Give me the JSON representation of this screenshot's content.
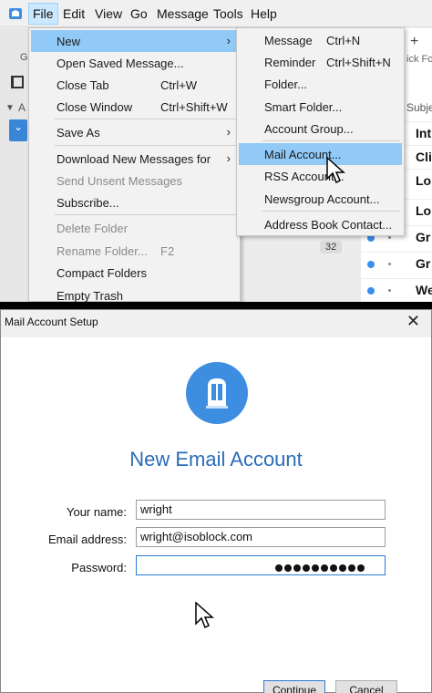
{
  "menubar": {
    "items": [
      "File",
      "Edit",
      "View",
      "Go",
      "Message",
      "Tools",
      "Help"
    ],
    "active": "File"
  },
  "background": {
    "left_toolbar_text": "G",
    "account_label": "A",
    "quick_filter_text": "ick Fo",
    "subject_header": "Subje",
    "message_rows": [
      "Int",
      "Cli",
      "Lo",
      "Lo",
      "Gr",
      "Gr",
      "We"
    ],
    "unread_count": "32"
  },
  "file_menu": {
    "items": [
      {
        "label": "New",
        "shortcut": "",
        "submenu": true,
        "disabled": false,
        "highlighted": true
      },
      {
        "label": "Open Saved Message...",
        "shortcut": "",
        "submenu": false,
        "disabled": false
      },
      {
        "label": "Close Tab",
        "shortcut": "Ctrl+W",
        "submenu": false,
        "disabled": false
      },
      {
        "label": "Close Window",
        "shortcut": "Ctrl+Shift+W",
        "submenu": false,
        "disabled": false
      },
      {
        "label": "Save As",
        "shortcut": "",
        "submenu": true,
        "disabled": false
      },
      {
        "label": "Download New Messages for",
        "shortcut": "",
        "submenu": true,
        "disabled": false
      },
      {
        "label": "Send Unsent Messages",
        "shortcut": "",
        "submenu": false,
        "disabled": true
      },
      {
        "label": "Subscribe...",
        "shortcut": "",
        "submenu": false,
        "disabled": false
      },
      {
        "label": "Delete Folder",
        "shortcut": "",
        "submenu": false,
        "disabled": true
      },
      {
        "label": "Rename Folder...",
        "shortcut": "F2",
        "submenu": false,
        "disabled": true
      },
      {
        "label": "Compact Folders",
        "shortcut": "",
        "submenu": false,
        "disabled": false
      },
      {
        "label": "Empty Trash",
        "shortcut": "",
        "submenu": false,
        "disabled": false
      }
    ]
  },
  "new_submenu": {
    "items": [
      {
        "label": "Message",
        "shortcut": "Ctrl+N"
      },
      {
        "label": "Reminder",
        "shortcut": "Ctrl+Shift+N"
      },
      {
        "label": "Folder...",
        "shortcut": ""
      },
      {
        "label": "Smart Folder...",
        "shortcut": ""
      },
      {
        "label": "Account Group...",
        "shortcut": ""
      },
      {
        "label": "Mail Account...",
        "shortcut": "",
        "highlighted": true
      },
      {
        "label": "RSS Account...",
        "shortcut": ""
      },
      {
        "label": "Newsgroup Account...",
        "shortcut": ""
      },
      {
        "label": "Address Book Contact...",
        "shortcut": ""
      }
    ]
  },
  "dialog": {
    "title": "Mail Account Setup",
    "close_icon": "close-icon",
    "logo_icon": "mailbox-icon",
    "headline": "New Email Account",
    "fields": {
      "name_label": "Your name:",
      "name_value": "wright",
      "email_label": "Email address:",
      "email_value": "wright@isoblock.com",
      "password_label": "Password:",
      "password_mask_length": 10
    },
    "buttons": {
      "continue": "Continue",
      "cancel": "Cancel"
    }
  },
  "colors": {
    "menu_highlight": "#91c9f7",
    "accent_blue": "#3d8ee0",
    "headline_blue": "#2b6cb8"
  }
}
